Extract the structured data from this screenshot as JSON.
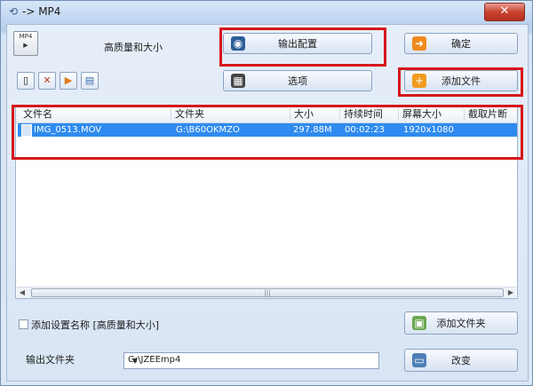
{
  "window": {
    "title": "-> MP4",
    "close_symbol": "✕"
  },
  "profile": {
    "label": "高质量和大小"
  },
  "buttons": {
    "output_config": "输出配置",
    "ok": "确定",
    "options": "选项",
    "add_file": "添加文件",
    "add_folder": "添加文件夹",
    "change": "改变"
  },
  "small_buttons": [
    {
      "name": "remove-file-button",
      "glyph": "▯",
      "icon": "delete-file-icon"
    },
    {
      "name": "clear-list-button",
      "glyph": "✕",
      "icon": "clear-icon"
    },
    {
      "name": "play-button",
      "glyph": "▶",
      "icon": "play-icon"
    },
    {
      "name": "info-button",
      "glyph": "▤",
      "icon": "info-icon"
    }
  ],
  "file_list": {
    "columns": [
      "文件名",
      "文件夹",
      "大小",
      "持续时间",
      "屏幕大小",
      "截取片断"
    ],
    "rows": [
      {
        "name": "IMG_0513.MOV",
        "folder": "G:\\B60OKMZO",
        "size": "297.88M",
        "duration": "00:02:23",
        "resolution": "1920x1080",
        "clip": ""
      }
    ]
  },
  "footer": {
    "add_settings_label": "添加设置名称 [高质量和大小]",
    "output_folder_label": "输出文件夹",
    "output_folder_value": "G:\\JZEEmp4"
  },
  "colors": {
    "highlight": "#d6161b",
    "selection": "#2f8bf0"
  }
}
